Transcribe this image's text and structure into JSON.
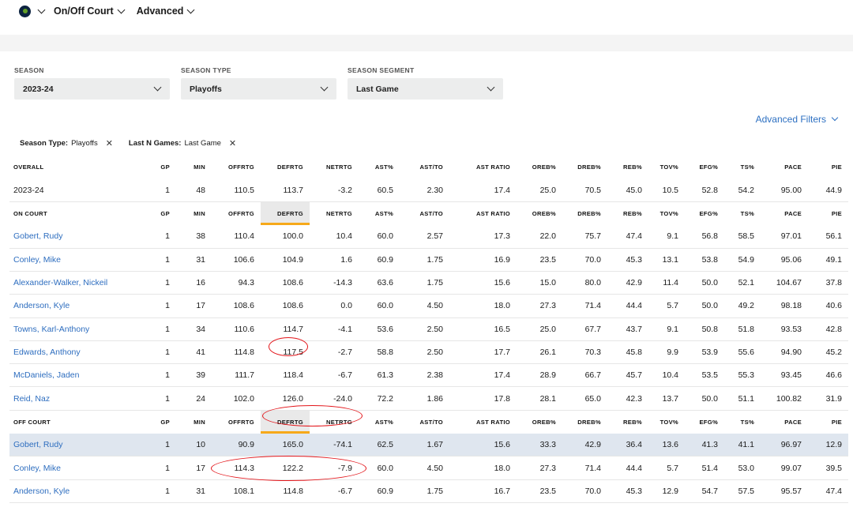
{
  "nav": {
    "items": [
      {
        "label": "On/Off Court"
      },
      {
        "label": "Advanced"
      }
    ]
  },
  "filters": [
    {
      "label": "SEASON",
      "value": "2023-24"
    },
    {
      "label": "SEASON TYPE",
      "value": "Playoffs"
    },
    {
      "label": "SEASON SEGMENT",
      "value": "Last Game"
    }
  ],
  "advanced_filters_label": "Advanced Filters",
  "chips": [
    {
      "key": "Season Type:",
      "value": "Playoffs"
    },
    {
      "key": "Last N Games:",
      "value": "Last Game"
    }
  ],
  "columns": [
    "GP",
    "MIN",
    "OFFRTG",
    "DEFRTG",
    "NETRTG",
    "AST%",
    "AST/TO",
    "AST RATIO",
    "OREB%",
    "DREB%",
    "REB%",
    "TOV%",
    "EFG%",
    "TS%",
    "PACE",
    "PIE"
  ],
  "overall": {
    "header": "OVERALL",
    "rows": [
      {
        "name": "2023-24",
        "values": [
          "1",
          "48",
          "110.5",
          "113.7",
          "-3.2",
          "60.5",
          "2.30",
          "17.4",
          "25.0",
          "70.5",
          "45.0",
          "10.5",
          "52.8",
          "54.2",
          "95.00",
          "44.9"
        ]
      }
    ]
  },
  "on_court": {
    "header": "ON COURT",
    "rows": [
      {
        "name": "Gobert, Rudy",
        "values": [
          "1",
          "38",
          "110.4",
          "100.0",
          "10.4",
          "60.0",
          "2.57",
          "17.3",
          "22.0",
          "75.7",
          "47.4",
          "9.1",
          "56.8",
          "58.5",
          "97.01",
          "56.1"
        ]
      },
      {
        "name": "Conley, Mike",
        "values": [
          "1",
          "31",
          "106.6",
          "104.9",
          "1.6",
          "60.9",
          "1.75",
          "16.9",
          "23.5",
          "70.0",
          "45.3",
          "13.1",
          "53.8",
          "54.9",
          "95.06",
          "49.1"
        ]
      },
      {
        "name": "Alexander-Walker, Nickeil",
        "values": [
          "1",
          "16",
          "94.3",
          "108.6",
          "-14.3",
          "63.6",
          "1.75",
          "15.6",
          "15.0",
          "80.0",
          "42.9",
          "11.4",
          "50.0",
          "52.1",
          "104.67",
          "37.8"
        ]
      },
      {
        "name": "Anderson, Kyle",
        "values": [
          "1",
          "17",
          "108.6",
          "108.6",
          "0.0",
          "60.0",
          "4.50",
          "18.0",
          "27.3",
          "71.4",
          "44.4",
          "5.7",
          "50.0",
          "49.2",
          "98.18",
          "40.6"
        ]
      },
      {
        "name": "Towns, Karl-Anthony",
        "values": [
          "1",
          "34",
          "110.6",
          "114.7",
          "-4.1",
          "53.6",
          "2.50",
          "16.5",
          "25.0",
          "67.7",
          "43.7",
          "9.1",
          "50.8",
          "51.8",
          "93.53",
          "42.8"
        ]
      },
      {
        "name": "Edwards, Anthony",
        "values": [
          "1",
          "41",
          "114.8",
          "117.5",
          "-2.7",
          "58.8",
          "2.50",
          "17.7",
          "26.1",
          "70.3",
          "45.8",
          "9.9",
          "53.9",
          "55.6",
          "94.90",
          "45.2"
        ]
      },
      {
        "name": "McDaniels, Jaden",
        "values": [
          "1",
          "39",
          "111.7",
          "118.4",
          "-6.7",
          "61.3",
          "2.38",
          "17.4",
          "28.9",
          "66.7",
          "45.7",
          "10.4",
          "53.5",
          "55.3",
          "93.45",
          "46.6"
        ]
      },
      {
        "name": "Reid, Naz",
        "values": [
          "1",
          "24",
          "102.0",
          "126.0",
          "-24.0",
          "72.2",
          "1.86",
          "17.8",
          "28.1",
          "65.0",
          "42.3",
          "13.7",
          "50.0",
          "51.1",
          "100.82",
          "31.9"
        ]
      }
    ]
  },
  "off_court": {
    "header": "OFF COURT",
    "rows": [
      {
        "name": "Gobert, Rudy",
        "values": [
          "1",
          "10",
          "90.9",
          "165.0",
          "-74.1",
          "62.5",
          "1.67",
          "15.6",
          "33.3",
          "42.9",
          "36.4",
          "13.6",
          "41.3",
          "41.1",
          "96.97",
          "12.9"
        ]
      },
      {
        "name": "Conley, Mike",
        "values": [
          "1",
          "17",
          "114.3",
          "122.2",
          "-7.9",
          "60.0",
          "4.50",
          "18.0",
          "27.3",
          "71.4",
          "44.4",
          "5.7",
          "51.4",
          "53.0",
          "99.07",
          "39.5"
        ]
      },
      {
        "name": "Anderson, Kyle",
        "values": [
          "1",
          "31",
          "108.1",
          "114.8",
          "-6.7",
          "60.9",
          "1.75",
          "16.7",
          "23.5",
          "70.0",
          "45.3",
          "12.9",
          "54.7",
          "57.5",
          "95.57",
          "47.4"
        ]
      }
    ]
  },
  "colors": {
    "link": "#2d6dbf",
    "sort_accent": "#f6a91a",
    "highlight_row": "#dfe6ef",
    "annotation": "#e3161b"
  }
}
